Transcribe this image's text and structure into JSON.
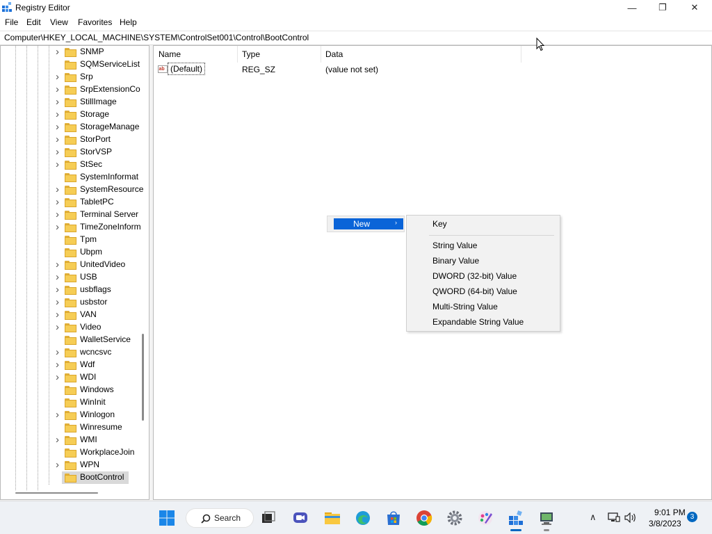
{
  "window": {
    "title": "Registry Editor",
    "minimize_glyph": "—",
    "maximize_glyph": "❐",
    "close_glyph": "✕"
  },
  "menu": [
    "File",
    "Edit",
    "View",
    "Favorites",
    "Help"
  ],
  "address": "Computer\\HKEY_LOCAL_MACHINE\\SYSTEM\\ControlSet001\\Control\\BootControl",
  "tree": {
    "items": [
      {
        "label": "SNMP",
        "expandable": true
      },
      {
        "label": "SQMServiceList",
        "expandable": false
      },
      {
        "label": "Srp",
        "expandable": true
      },
      {
        "label": "SrpExtensionCo",
        "expandable": true
      },
      {
        "label": "StillImage",
        "expandable": true
      },
      {
        "label": "Storage",
        "expandable": true
      },
      {
        "label": "StorageManage",
        "expandable": true
      },
      {
        "label": "StorPort",
        "expandable": true
      },
      {
        "label": "StorVSP",
        "expandable": true
      },
      {
        "label": "StSec",
        "expandable": true
      },
      {
        "label": "SystemInformat",
        "expandable": false
      },
      {
        "label": "SystemResource",
        "expandable": true
      },
      {
        "label": "TabletPC",
        "expandable": true
      },
      {
        "label": "Terminal Server",
        "expandable": true
      },
      {
        "label": "TimeZoneInform",
        "expandable": true
      },
      {
        "label": "Tpm",
        "expandable": false
      },
      {
        "label": "Ubpm",
        "expandable": false
      },
      {
        "label": "UnitedVideo",
        "expandable": true
      },
      {
        "label": "USB",
        "expandable": true
      },
      {
        "label": "usbflags",
        "expandable": true
      },
      {
        "label": "usbstor",
        "expandable": true
      },
      {
        "label": "VAN",
        "expandable": true
      },
      {
        "label": "Video",
        "expandable": true
      },
      {
        "label": "WalletService",
        "expandable": false
      },
      {
        "label": "wcncsvc",
        "expandable": true
      },
      {
        "label": "Wdf",
        "expandable": true
      },
      {
        "label": "WDI",
        "expandable": true
      },
      {
        "label": "Windows",
        "expandable": false
      },
      {
        "label": "WinInit",
        "expandable": false
      },
      {
        "label": "Winlogon",
        "expandable": true
      },
      {
        "label": "Winresume",
        "expandable": false
      },
      {
        "label": "WMI",
        "expandable": true
      },
      {
        "label": "WorkplaceJoin",
        "expandable": false
      },
      {
        "label": "WPN",
        "expandable": true
      },
      {
        "label": "BootControl",
        "expandable": false,
        "selected": true
      }
    ]
  },
  "list": {
    "columns": {
      "name": "Name",
      "type": "Type",
      "data": "Data"
    },
    "rows": [
      {
        "name": "(Default)",
        "type": "REG_SZ",
        "data": "(value not set)",
        "icon": "ab-string-icon"
      }
    ]
  },
  "context_menu": {
    "new_label": "New",
    "arrow": "›",
    "submenu": [
      "Key",
      "String Value",
      "Binary Value",
      "DWORD (32-bit) Value",
      "QWORD (64-bit) Value",
      "Multi-String Value",
      "Expandable String Value"
    ]
  },
  "taskbar": {
    "search_label": "Search",
    "icons": [
      "start-icon",
      "search-icon",
      "task-view-icon",
      "meet-icon",
      "file-explorer-icon",
      "edge-icon",
      "store-icon",
      "chrome-icon",
      "settings-icon",
      "paint-icon",
      "regedit-icon",
      "network-app-icon"
    ],
    "tray_chevron": "∧",
    "time": "9:01 PM",
    "date": "3/8/2023",
    "notifications": "3"
  },
  "colors": {
    "accent": "#0a64d8",
    "folder": "#f6cd55",
    "selection": "#d9d9d9"
  }
}
